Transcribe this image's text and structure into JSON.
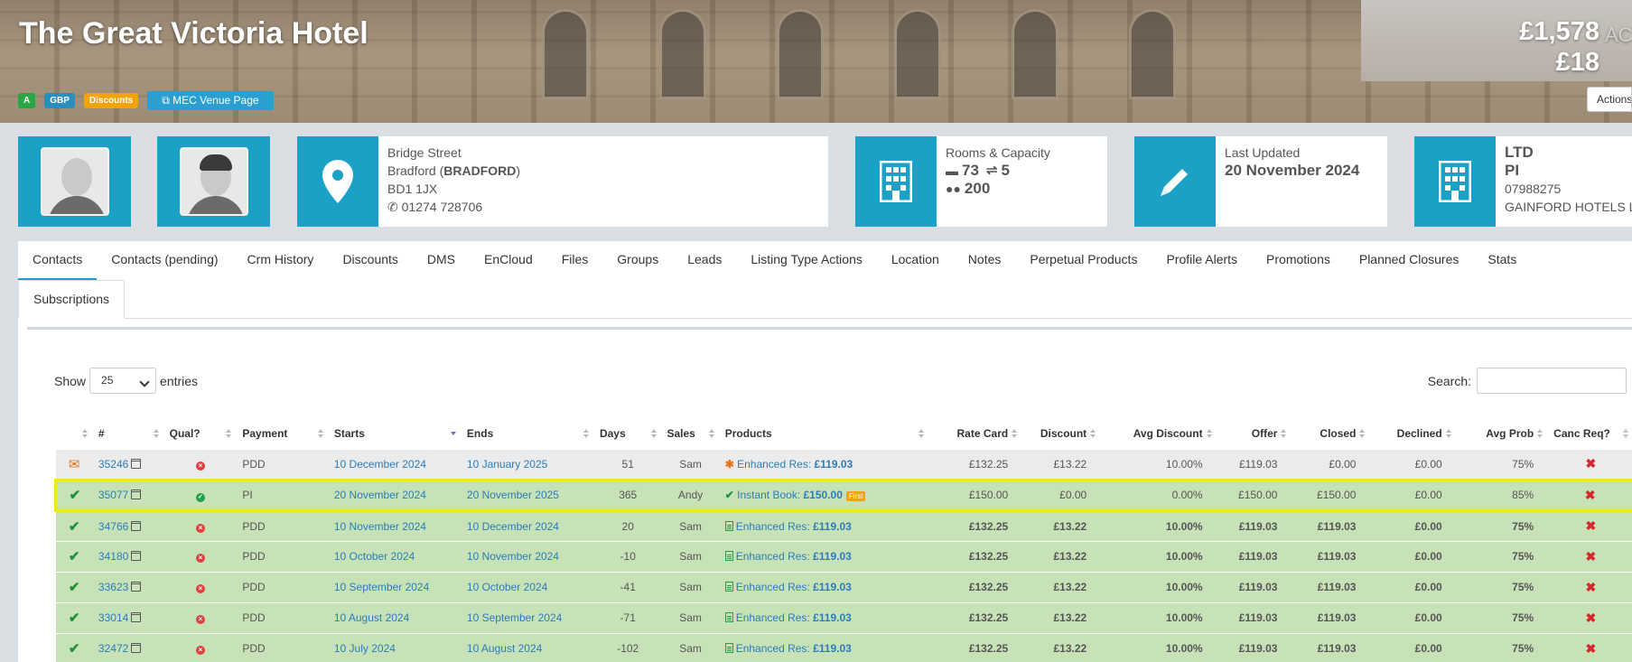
{
  "header": {
    "hotel_name": "The Great Victoria Hotel",
    "badges": {
      "grade": "A",
      "currency": "GBP",
      "discounts": "Discounts",
      "venue_page": "MEC Venue Page"
    },
    "amount_primary": "£1,578",
    "amount_primary_suffix": "ACT",
    "amount_secondary": "£18",
    "actions_label": "Actions"
  },
  "cards": {
    "address": {
      "street": "Bridge Street",
      "city": "Bradford",
      "county": "BRADFORD",
      "postcode": "BD1 1JX",
      "phone": "01274 728706"
    },
    "capacity": {
      "title": "Rooms & Capacity",
      "rooms": "73",
      "meeting_rooms": "5",
      "people": "200"
    },
    "updated": {
      "title": "Last Updated",
      "date": "20 November 2024"
    },
    "company": {
      "line1": "LTD",
      "line2": "PI",
      "number": "07988275",
      "name": "GAINFORD HOTELS L"
    }
  },
  "tabs": [
    "Contacts",
    "Contacts (pending)",
    "Crm History",
    "Discounts",
    "DMS",
    "EnCloud",
    "Files",
    "Groups",
    "Leads",
    "Listing Type Actions",
    "Location",
    "Notes",
    "Perpetual Products",
    "Profile Alerts",
    "Promotions",
    "Planned Closures",
    "Stats"
  ],
  "tab_sub": "Subscriptions",
  "table_controls": {
    "show_label": "Show",
    "entries_value": "25",
    "entries_label": "entries",
    "search_label": "Search:"
  },
  "columns": [
    "#",
    "Qual?",
    "Payment",
    "Starts",
    "Ends",
    "Days",
    "Sales",
    "Products",
    "Rate Card",
    "Discount",
    "Avg Discount",
    "Offer",
    "Closed",
    "Declined",
    "Avg Prob",
    "Canc Req?"
  ],
  "rows": [
    {
      "status": "mail",
      "id": "35246",
      "qual": "no",
      "payment": "PDD",
      "starts": "10 December 2024",
      "ends": "10 January 2025",
      "days": "51",
      "sales": "Sam",
      "product_icon": "asterisk",
      "product_name": "Enhanced Res:",
      "product_price": "£119.03",
      "product_tag": "",
      "rate_card": "£132.25",
      "discount": "£13.22",
      "avg_discount": "10.00%",
      "offer": "£119.03",
      "closed": "£0.00",
      "declined": "£0.00",
      "avg_prob": "75%",
      "bold": false,
      "highlight": false
    },
    {
      "status": "check",
      "id": "35077",
      "qual": "yes",
      "payment": "PI",
      "starts": "20 November 2024",
      "ends": "20 November 2025",
      "days": "365",
      "sales": "Andy",
      "product_icon": "check",
      "product_name": "Instant Book:",
      "product_price": "£150.00",
      "product_tag": "First",
      "rate_card": "£150.00",
      "discount": "£0.00",
      "avg_discount": "0.00%",
      "offer": "£150.00",
      "closed": "£150.00",
      "declined": "£0.00",
      "avg_prob": "85%",
      "bold": false,
      "highlight": true
    },
    {
      "status": "check",
      "id": "34766",
      "qual": "no",
      "payment": "PDD",
      "starts": "10 November 2024",
      "ends": "10 December 2024",
      "days": "20",
      "sales": "Sam",
      "product_icon": "doc",
      "product_name": "Enhanced Res:",
      "product_price": "£119.03",
      "product_tag": "",
      "rate_card": "£132.25",
      "discount": "£13.22",
      "avg_discount": "10.00%",
      "offer": "£119.03",
      "closed": "£119.03",
      "declined": "£0.00",
      "avg_prob": "75%",
      "bold": true,
      "highlight": false
    },
    {
      "status": "check",
      "id": "34180",
      "qual": "no",
      "payment": "PDD",
      "starts": "10 October 2024",
      "ends": "10 November 2024",
      "days": "-10",
      "sales": "Sam",
      "product_icon": "doc",
      "product_name": "Enhanced Res:",
      "product_price": "£119.03",
      "product_tag": "",
      "rate_card": "£132.25",
      "discount": "£13.22",
      "avg_discount": "10.00%",
      "offer": "£119.03",
      "closed": "£119.03",
      "declined": "£0.00",
      "avg_prob": "75%",
      "bold": true,
      "highlight": false
    },
    {
      "status": "check",
      "id": "33623",
      "qual": "no",
      "payment": "PDD",
      "starts": "10 September 2024",
      "ends": "10 October 2024",
      "days": "-41",
      "sales": "Sam",
      "product_icon": "doc",
      "product_name": "Enhanced Res:",
      "product_price": "£119.03",
      "product_tag": "",
      "rate_card": "£132.25",
      "discount": "£13.22",
      "avg_discount": "10.00%",
      "offer": "£119.03",
      "closed": "£119.03",
      "declined": "£0.00",
      "avg_prob": "75%",
      "bold": true,
      "highlight": false
    },
    {
      "status": "check",
      "id": "33014",
      "qual": "no",
      "payment": "PDD",
      "starts": "10 August 2024",
      "ends": "10 September 2024",
      "days": "-71",
      "sales": "Sam",
      "product_icon": "doc",
      "product_name": "Enhanced Res:",
      "product_price": "£119.03",
      "product_tag": "",
      "rate_card": "£132.25",
      "discount": "£13.22",
      "avg_discount": "10.00%",
      "offer": "£119.03",
      "closed": "£119.03",
      "declined": "£0.00",
      "avg_prob": "75%",
      "bold": true,
      "highlight": false
    },
    {
      "status": "check",
      "id": "32472",
      "qual": "no",
      "payment": "PDD",
      "starts": "10 July 2024",
      "ends": "10 August 2024",
      "days": "-102",
      "sales": "Sam",
      "product_icon": "doc",
      "product_name": "Enhanced Res:",
      "product_price": "£119.03",
      "product_tag": "",
      "rate_card": "£132.25",
      "discount": "£13.22",
      "avg_discount": "10.00%",
      "offer": "£119.03",
      "closed": "£119.03",
      "declined": "£0.00",
      "avg_prob": "75%",
      "bold": true,
      "highlight": false
    }
  ],
  "colors": {
    "accent": "#1ba0c6",
    "row_green": "#c8e2b8",
    "highlight": "#f4e717",
    "link": "#2a7db8"
  }
}
